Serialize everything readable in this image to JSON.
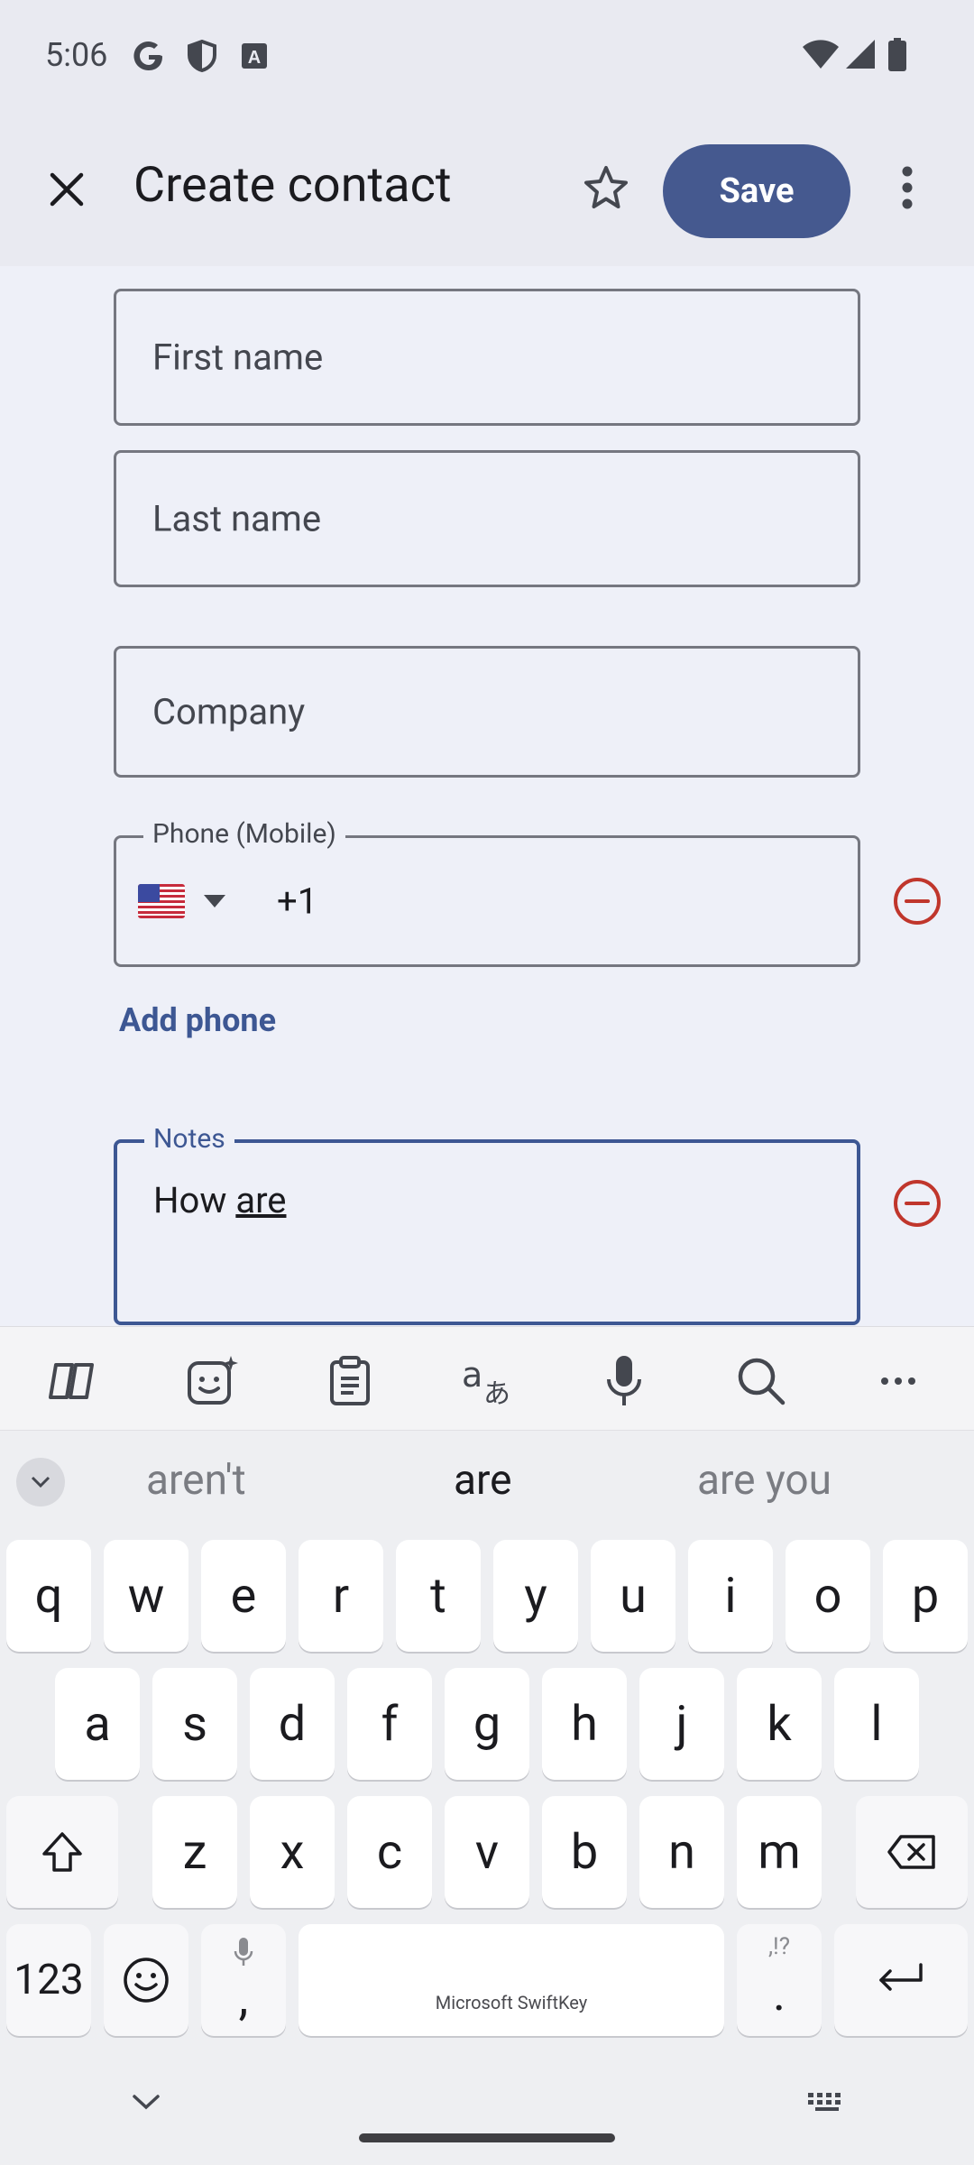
{
  "status_bar": {
    "time": "5:06",
    "left_icons": [
      "google-icon",
      "shield-icon",
      "font-a-icon"
    ],
    "right_icons": [
      "wifi-icon",
      "signal-icon",
      "battery-icon"
    ]
  },
  "app_bar": {
    "title": "Create contact",
    "save_label": "Save"
  },
  "form": {
    "first_name_placeholder": "First name",
    "last_name_placeholder": "Last name",
    "company_placeholder": "Company",
    "phone_label": "Phone (Mobile)",
    "phone_country_flag": "🇺🇸",
    "phone_prefix": "+1",
    "add_phone_label": "Add phone",
    "notes_label": "Notes",
    "notes_value_prefix": "How ",
    "notes_value_composing": "are"
  },
  "keyboard": {
    "suggestions": [
      "aren't",
      "are",
      "are you"
    ],
    "row1": [
      "q",
      "w",
      "e",
      "r",
      "t",
      "y",
      "u",
      "i",
      "o",
      "p"
    ],
    "row2": [
      "a",
      "s",
      "d",
      "f",
      "g",
      "h",
      "j",
      "k",
      "l"
    ],
    "row3": [
      "z",
      "x",
      "c",
      "v",
      "b",
      "n",
      "m"
    ],
    "numbers_label": "123",
    "comma_label": ",",
    "period_label": ".",
    "period_hint": ",!?",
    "space_label": "Microsoft SwiftKey"
  },
  "colors": {
    "accent": "#45598f",
    "link": "#3d5793",
    "remove_red": "#c0362c",
    "focused_border": "#3d5793"
  }
}
